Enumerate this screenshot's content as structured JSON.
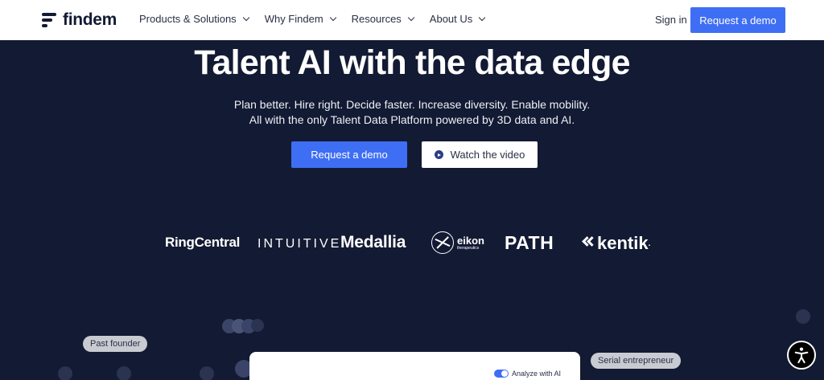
{
  "nav": {
    "logo_text": "findem",
    "menu": [
      {
        "label": "Products & Solutions"
      },
      {
        "label": "Why Findem"
      },
      {
        "label": "Resources"
      },
      {
        "label": "About Us"
      }
    ],
    "sign_in": "Sign in",
    "cta": "Request a demo"
  },
  "hero": {
    "title": "Talent AI with the data edge",
    "subtitle_line1": "Plan better. Hire right. Decide faster. Increase diversity. Enable mobility.",
    "subtitle_line2": "All with the only Talent Data Platform powered by 3D data and AI.",
    "primary_button": "Request a demo",
    "secondary_button": "Watch the video"
  },
  "customers": {
    "logos": [
      "RingCentral",
      "INTUITIVE",
      "Medallia",
      "eikon",
      "PATH",
      "kentik"
    ],
    "eikon_sub": "therapeutics",
    "kentik_trademark": "."
  },
  "visual": {
    "pill_left": "Past founder",
    "pill_right": "Serial entrepreneur",
    "toggle_label": "Analyze with AI",
    "toggle_on": true
  },
  "icons": {
    "dropdown": "chevron-down-icon",
    "play": "play-icon",
    "accessibility": "accessibility-icon"
  },
  "colors": {
    "background": "#131a33",
    "accent": "#3e6ef4",
    "nav_bg": "#ffffff"
  }
}
